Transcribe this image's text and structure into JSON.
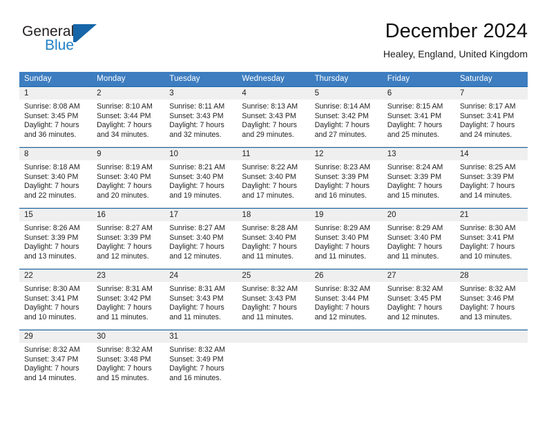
{
  "brand": {
    "name_part1": "General",
    "name_part2": "Blue",
    "mark_icon": "triangle-flag-icon",
    "color_blue": "#1565a8",
    "color_blue_text": "#1f7fc4"
  },
  "header": {
    "month_title": "December 2024",
    "location": "Healey, England, United Kingdom"
  },
  "calendar": {
    "header_bg": "#3d7dc0",
    "day_band_bg": "#efefef",
    "weekdays": [
      "Sunday",
      "Monday",
      "Tuesday",
      "Wednesday",
      "Thursday",
      "Friday",
      "Saturday"
    ],
    "weeks": [
      [
        {
          "date": "1",
          "sunrise": "Sunrise: 8:08 AM",
          "sunset": "Sunset: 3:45 PM",
          "daylight_line1": "Daylight: 7 hours",
          "daylight_line2": "and 36 minutes."
        },
        {
          "date": "2",
          "sunrise": "Sunrise: 8:10 AM",
          "sunset": "Sunset: 3:44 PM",
          "daylight_line1": "Daylight: 7 hours",
          "daylight_line2": "and 34 minutes."
        },
        {
          "date": "3",
          "sunrise": "Sunrise: 8:11 AM",
          "sunset": "Sunset: 3:43 PM",
          "daylight_line1": "Daylight: 7 hours",
          "daylight_line2": "and 32 minutes."
        },
        {
          "date": "4",
          "sunrise": "Sunrise: 8:13 AM",
          "sunset": "Sunset: 3:43 PM",
          "daylight_line1": "Daylight: 7 hours",
          "daylight_line2": "and 29 minutes."
        },
        {
          "date": "5",
          "sunrise": "Sunrise: 8:14 AM",
          "sunset": "Sunset: 3:42 PM",
          "daylight_line1": "Daylight: 7 hours",
          "daylight_line2": "and 27 minutes."
        },
        {
          "date": "6",
          "sunrise": "Sunrise: 8:15 AM",
          "sunset": "Sunset: 3:41 PM",
          "daylight_line1": "Daylight: 7 hours",
          "daylight_line2": "and 25 minutes."
        },
        {
          "date": "7",
          "sunrise": "Sunrise: 8:17 AM",
          "sunset": "Sunset: 3:41 PM",
          "daylight_line1": "Daylight: 7 hours",
          "daylight_line2": "and 24 minutes."
        }
      ],
      [
        {
          "date": "8",
          "sunrise": "Sunrise: 8:18 AM",
          "sunset": "Sunset: 3:40 PM",
          "daylight_line1": "Daylight: 7 hours",
          "daylight_line2": "and 22 minutes."
        },
        {
          "date": "9",
          "sunrise": "Sunrise: 8:19 AM",
          "sunset": "Sunset: 3:40 PM",
          "daylight_line1": "Daylight: 7 hours",
          "daylight_line2": "and 20 minutes."
        },
        {
          "date": "10",
          "sunrise": "Sunrise: 8:21 AM",
          "sunset": "Sunset: 3:40 PM",
          "daylight_line1": "Daylight: 7 hours",
          "daylight_line2": "and 19 minutes."
        },
        {
          "date": "11",
          "sunrise": "Sunrise: 8:22 AM",
          "sunset": "Sunset: 3:40 PM",
          "daylight_line1": "Daylight: 7 hours",
          "daylight_line2": "and 17 minutes."
        },
        {
          "date": "12",
          "sunrise": "Sunrise: 8:23 AM",
          "sunset": "Sunset: 3:39 PM",
          "daylight_line1": "Daylight: 7 hours",
          "daylight_line2": "and 16 minutes."
        },
        {
          "date": "13",
          "sunrise": "Sunrise: 8:24 AM",
          "sunset": "Sunset: 3:39 PM",
          "daylight_line1": "Daylight: 7 hours",
          "daylight_line2": "and 15 minutes."
        },
        {
          "date": "14",
          "sunrise": "Sunrise: 8:25 AM",
          "sunset": "Sunset: 3:39 PM",
          "daylight_line1": "Daylight: 7 hours",
          "daylight_line2": "and 14 minutes."
        }
      ],
      [
        {
          "date": "15",
          "sunrise": "Sunrise: 8:26 AM",
          "sunset": "Sunset: 3:39 PM",
          "daylight_line1": "Daylight: 7 hours",
          "daylight_line2": "and 13 minutes."
        },
        {
          "date": "16",
          "sunrise": "Sunrise: 8:27 AM",
          "sunset": "Sunset: 3:39 PM",
          "daylight_line1": "Daylight: 7 hours",
          "daylight_line2": "and 12 minutes."
        },
        {
          "date": "17",
          "sunrise": "Sunrise: 8:27 AM",
          "sunset": "Sunset: 3:40 PM",
          "daylight_line1": "Daylight: 7 hours",
          "daylight_line2": "and 12 minutes."
        },
        {
          "date": "18",
          "sunrise": "Sunrise: 8:28 AM",
          "sunset": "Sunset: 3:40 PM",
          "daylight_line1": "Daylight: 7 hours",
          "daylight_line2": "and 11 minutes."
        },
        {
          "date": "19",
          "sunrise": "Sunrise: 8:29 AM",
          "sunset": "Sunset: 3:40 PM",
          "daylight_line1": "Daylight: 7 hours",
          "daylight_line2": "and 11 minutes."
        },
        {
          "date": "20",
          "sunrise": "Sunrise: 8:29 AM",
          "sunset": "Sunset: 3:40 PM",
          "daylight_line1": "Daylight: 7 hours",
          "daylight_line2": "and 11 minutes."
        },
        {
          "date": "21",
          "sunrise": "Sunrise: 8:30 AM",
          "sunset": "Sunset: 3:41 PM",
          "daylight_line1": "Daylight: 7 hours",
          "daylight_line2": "and 10 minutes."
        }
      ],
      [
        {
          "date": "22",
          "sunrise": "Sunrise: 8:30 AM",
          "sunset": "Sunset: 3:41 PM",
          "daylight_line1": "Daylight: 7 hours",
          "daylight_line2": "and 10 minutes."
        },
        {
          "date": "23",
          "sunrise": "Sunrise: 8:31 AM",
          "sunset": "Sunset: 3:42 PM",
          "daylight_line1": "Daylight: 7 hours",
          "daylight_line2": "and 11 minutes."
        },
        {
          "date": "24",
          "sunrise": "Sunrise: 8:31 AM",
          "sunset": "Sunset: 3:43 PM",
          "daylight_line1": "Daylight: 7 hours",
          "daylight_line2": "and 11 minutes."
        },
        {
          "date": "25",
          "sunrise": "Sunrise: 8:32 AM",
          "sunset": "Sunset: 3:43 PM",
          "daylight_line1": "Daylight: 7 hours",
          "daylight_line2": "and 11 minutes."
        },
        {
          "date": "26",
          "sunrise": "Sunrise: 8:32 AM",
          "sunset": "Sunset: 3:44 PM",
          "daylight_line1": "Daylight: 7 hours",
          "daylight_line2": "and 12 minutes."
        },
        {
          "date": "27",
          "sunrise": "Sunrise: 8:32 AM",
          "sunset": "Sunset: 3:45 PM",
          "daylight_line1": "Daylight: 7 hours",
          "daylight_line2": "and 12 minutes."
        },
        {
          "date": "28",
          "sunrise": "Sunrise: 8:32 AM",
          "sunset": "Sunset: 3:46 PM",
          "daylight_line1": "Daylight: 7 hours",
          "daylight_line2": "and 13 minutes."
        }
      ],
      [
        {
          "date": "29",
          "sunrise": "Sunrise: 8:32 AM",
          "sunset": "Sunset: 3:47 PM",
          "daylight_line1": "Daylight: 7 hours",
          "daylight_line2": "and 14 minutes."
        },
        {
          "date": "30",
          "sunrise": "Sunrise: 8:32 AM",
          "sunset": "Sunset: 3:48 PM",
          "daylight_line1": "Daylight: 7 hours",
          "daylight_line2": "and 15 minutes."
        },
        {
          "date": "31",
          "sunrise": "Sunrise: 8:32 AM",
          "sunset": "Sunset: 3:49 PM",
          "daylight_line1": "Daylight: 7 hours",
          "daylight_line2": "and 16 minutes."
        },
        {
          "date": "",
          "sunrise": "",
          "sunset": "",
          "daylight_line1": "",
          "daylight_line2": ""
        },
        {
          "date": "",
          "sunrise": "",
          "sunset": "",
          "daylight_line1": "",
          "daylight_line2": ""
        },
        {
          "date": "",
          "sunrise": "",
          "sunset": "",
          "daylight_line1": "",
          "daylight_line2": ""
        },
        {
          "date": "",
          "sunrise": "",
          "sunset": "",
          "daylight_line1": "",
          "daylight_line2": ""
        }
      ]
    ]
  }
}
